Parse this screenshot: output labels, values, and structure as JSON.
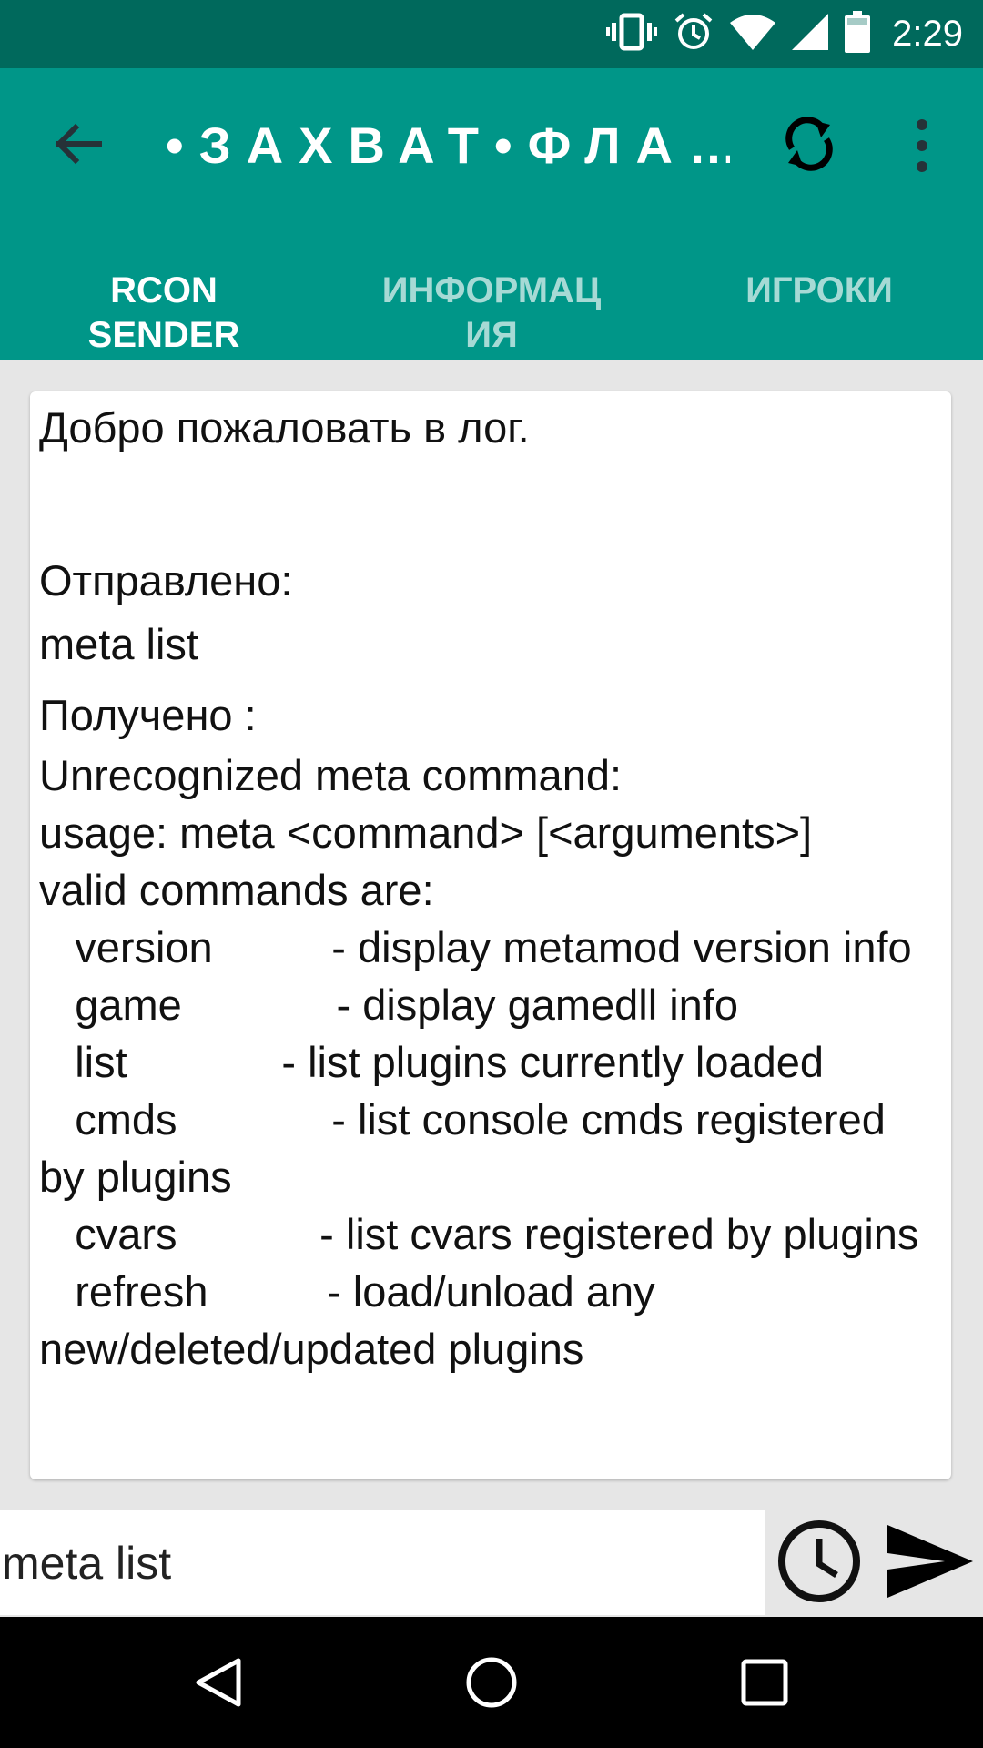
{
  "status_bar": {
    "time": "2:29",
    "icons": [
      "vibrate-icon",
      "alarm-icon",
      "wifi-icon",
      "signal-icon",
      "battery-icon"
    ]
  },
  "toolbar": {
    "title": "•ЗАХВАТ•ФЛА…",
    "back_icon": "arrow-back-icon",
    "refresh_icon": "refresh-icon",
    "menu_icon": "more-vert-icon"
  },
  "tabs": [
    {
      "label": "RCON\nSENDER",
      "active": true
    },
    {
      "label": "ИНФОРМАЦ\nИЯ",
      "active": false
    },
    {
      "label": "ИГРОКИ",
      "active": false
    }
  ],
  "log": {
    "welcome": "Добро пожаловать в лог.",
    "sent_label": "Отправлено:",
    "sent_command": "meta list",
    "received_label": "Получено :",
    "response": "Unrecognized meta command: \nusage: meta <command> [<arguments>]\nvalid commands are:\n   version          - display metamod version info\n   game             - display gamedll info\n   list             - list plugins currently loaded\n   cmds             - list console cmds registered by plugins\n   cvars            - list cvars registered by plugins\n   refresh          - load/unload any new/deleted/updated plugins"
  },
  "input": {
    "value": "meta list",
    "history_icon": "clock-icon",
    "send_icon": "send-icon"
  },
  "colors": {
    "primary": "#009688",
    "primary_dark": "#00695c",
    "background": "#e6e6e6"
  }
}
